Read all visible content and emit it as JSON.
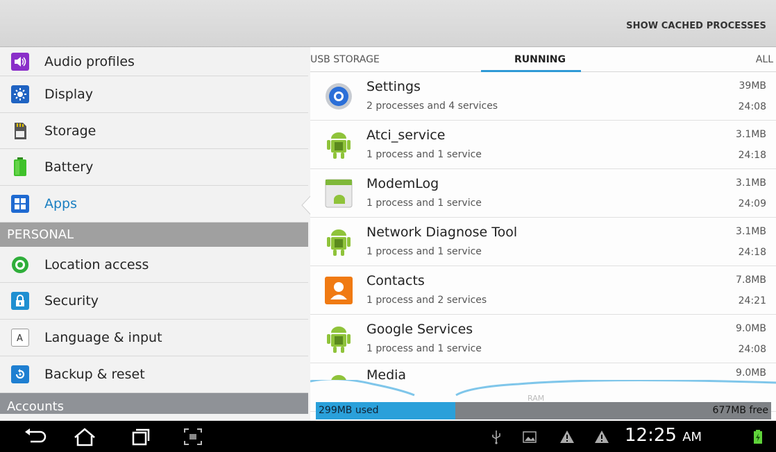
{
  "actionbar": {
    "cached_label": "SHOW CACHED PROCESSES"
  },
  "settings": {
    "items_top": [
      {
        "label": "Audio profiles",
        "icon": "audio-profiles-icon"
      },
      {
        "label": "Display",
        "icon": "display-icon"
      },
      {
        "label": "Storage",
        "icon": "storage-icon"
      },
      {
        "label": "Battery",
        "icon": "battery-icon"
      },
      {
        "label": "Apps",
        "icon": "apps-icon",
        "selected": true
      }
    ],
    "section_personal": "PERSONAL",
    "items_personal": [
      {
        "label": "Location access",
        "icon": "location-icon"
      },
      {
        "label": "Security",
        "icon": "lock-icon"
      },
      {
        "label": "Language & input",
        "icon": "keyboard-icon"
      },
      {
        "label": "Backup & reset",
        "icon": "backup-icon"
      }
    ],
    "section_accounts": "Accounts"
  },
  "tabs": {
    "usb": "USB STORAGE",
    "running": "RUNNING",
    "all": "ALL"
  },
  "processes": [
    {
      "name": "Settings",
      "desc": "2 processes and 4 services",
      "size": "39MB",
      "time": "24:08",
      "icon": "settings-gear-icon"
    },
    {
      "name": "Atci_service",
      "desc": "1 process and 1 service",
      "size": "3.1MB",
      "time": "24:18",
      "icon": "android-robot-icon"
    },
    {
      "name": "ModemLog",
      "desc": "1 process and 1 service",
      "size": "3.1MB",
      "time": "24:09",
      "icon": "android-app-icon"
    },
    {
      "name": "Network Diagnose Tool",
      "desc": "1 process and 1 service",
      "size": "3.1MB",
      "time": "24:18",
      "icon": "android-robot-icon"
    },
    {
      "name": "Contacts",
      "desc": "1 process and 2 services",
      "size": "7.8MB",
      "time": "24:21",
      "icon": "contacts-icon"
    },
    {
      "name": "Google Services",
      "desc": "1 process and 1 service",
      "size": "9.0MB",
      "time": "24:08",
      "icon": "android-robot-icon"
    },
    {
      "name": "Media",
      "desc": "",
      "size": "9.0MB",
      "time": "",
      "icon": "android-robot-icon"
    }
  ],
  "ram": {
    "label": "RAM",
    "used": "299MB used",
    "free": "677MB free",
    "used_fraction": 0.306
  },
  "statusbar": {
    "time": "12:25",
    "ampm": "AM"
  },
  "colors": {
    "accent": "#2f9ad6",
    "selected_text": "#1a7fc1",
    "section_bg": "#a0a0a0"
  }
}
